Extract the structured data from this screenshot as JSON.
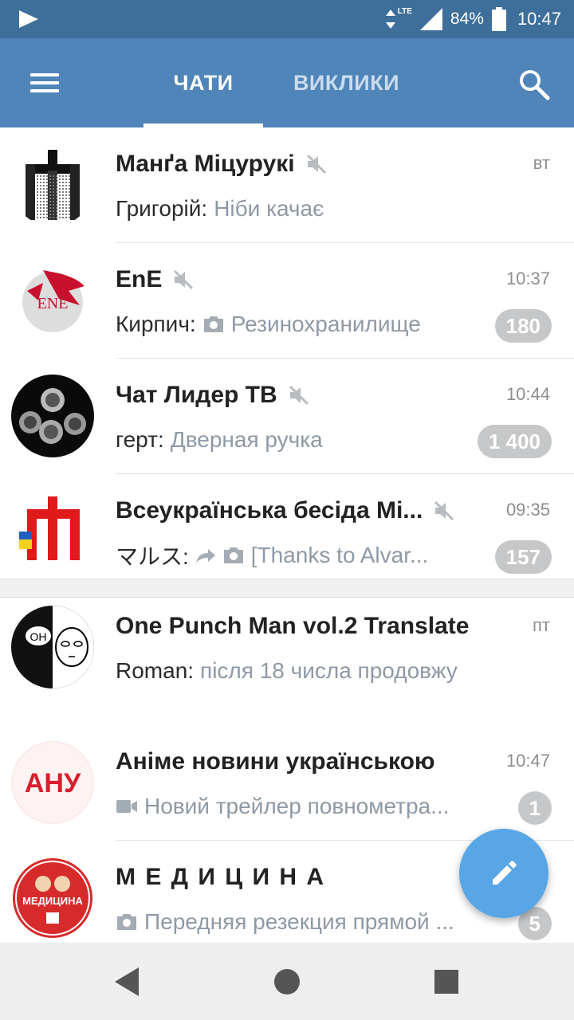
{
  "status_bar": {
    "network": "LTE",
    "battery": "84%",
    "time": "10:47"
  },
  "app_bar": {
    "tabs": [
      {
        "label": "ЧАТИ",
        "active": true
      },
      {
        "label": "ВИКЛИКИ",
        "active": false
      }
    ]
  },
  "chats": [
    {
      "title": "Манґа Міцурукі",
      "muted": true,
      "time": "вт",
      "sender": "Григорій:",
      "message": "Ніби качає",
      "badge": ""
    },
    {
      "title": "EnE",
      "muted": true,
      "time": "10:37",
      "sender": "Кирпич:",
      "message": "Резинохранилище",
      "badge": "180"
    },
    {
      "title": "Чат Лидер ТВ",
      "muted": true,
      "time": "10:44",
      "sender": "герт:",
      "message": "Дверная ручка",
      "badge": "1 400"
    },
    {
      "title": "Всеукраїнська бесіда Мі...",
      "muted": true,
      "time": "09:35",
      "sender": "マルス:",
      "message": "[Thanks to Alvar...",
      "badge": "157"
    },
    {
      "title": "One Punch Man vol.2 Translate",
      "muted": false,
      "time": "пт",
      "sender": "Roman:",
      "message": "після 18 числа продовжу",
      "badge": ""
    },
    {
      "title": "Аніме новини українською",
      "muted": false,
      "time": "10:47",
      "sender": "",
      "message": "Новий трейлер повнометра...",
      "badge": "1"
    },
    {
      "title": "М Е Д И Ц И Н А",
      "muted": false,
      "time": "",
      "sender": "",
      "message": "Передняя резекция прямой ...",
      "badge": "5"
    }
  ],
  "avatars": {
    "ene_text": "ENE",
    "anu_text": "АНУ",
    "opm_text": "OH",
    "med_text": "МЕДИЦИНА"
  },
  "colors": {
    "status_bar": "#3e6f9a",
    "app_bar": "#5085b9",
    "fab": "#58a6e6",
    "badge": "#c5c7c9"
  }
}
